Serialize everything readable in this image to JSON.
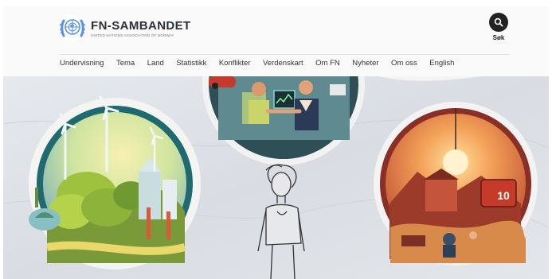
{
  "site": {
    "name": "FN-SAMBANDET",
    "tagline": "UNITED NATIONS ASSOCIATION OF NORWAY"
  },
  "search": {
    "label": "Søk",
    "icon": "search-icon"
  },
  "nav": {
    "items": [
      {
        "label": "Undervisning"
      },
      {
        "label": "Tema"
      },
      {
        "label": "Land"
      },
      {
        "label": "Statistikk"
      },
      {
        "label": "Konflikter"
      },
      {
        "label": "Verdenskart"
      },
      {
        "label": "Om FN"
      },
      {
        "label": "Nyheter"
      },
      {
        "label": "Om oss"
      },
      {
        "label": "English"
      }
    ]
  },
  "hero": {
    "badge_number": "10"
  },
  "colors": {
    "text_dark": "#2b3137",
    "un_blue": "#5b92e5",
    "hero_bg": "#dfe3e8"
  }
}
